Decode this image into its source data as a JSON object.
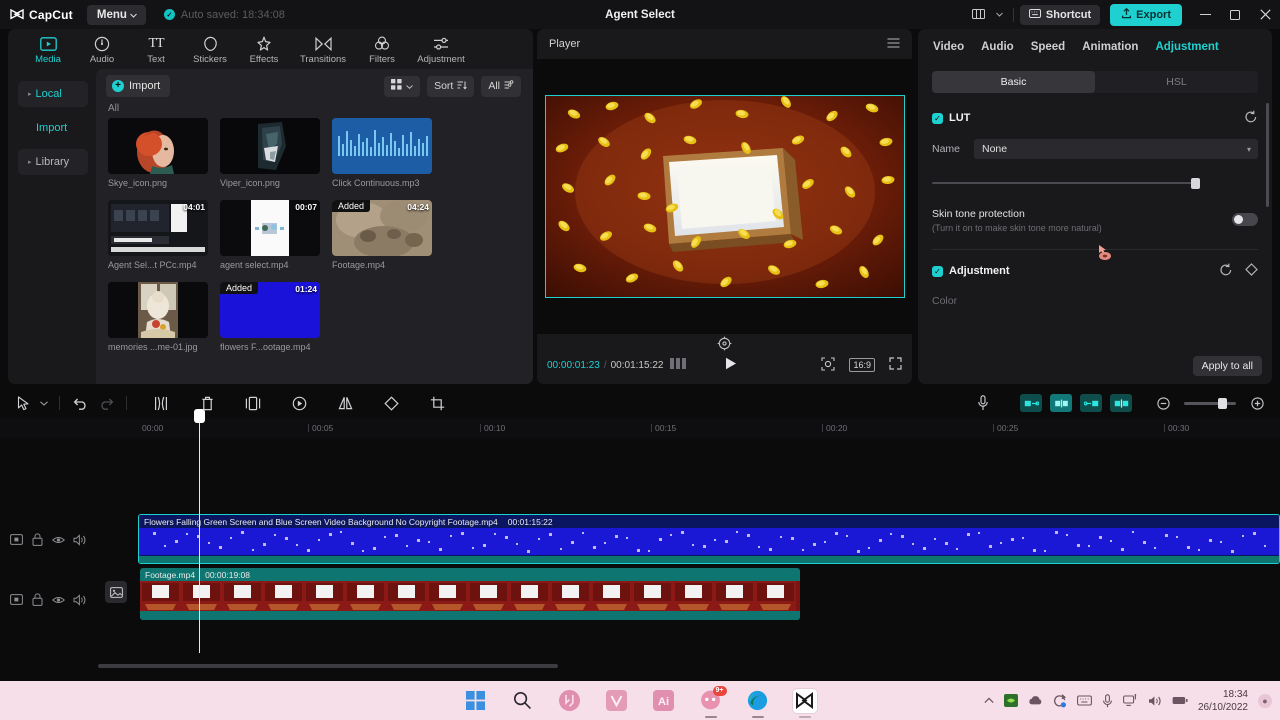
{
  "titlebar": {
    "app_name": "CapCut",
    "menu_label": "Menu",
    "autosave_text": "Auto saved: 18:34:08",
    "project_title": "Agent Select",
    "shortcut_label": "Shortcut",
    "export_label": "Export",
    "layout_icon": "layout-icon",
    "minimize_icon": "minimize-icon",
    "maximize_icon": "maximize-icon",
    "close_icon": "close-icon",
    "accent_color": "#1fd0d0"
  },
  "tooltabs": [
    {
      "label": "Media",
      "icon": "media-icon",
      "active": true
    },
    {
      "label": "Audio",
      "icon": "audio-icon",
      "active": false
    },
    {
      "label": "Text",
      "icon": "text-icon",
      "active": false
    },
    {
      "label": "Stickers",
      "icon": "stickers-icon",
      "active": false
    },
    {
      "label": "Effects",
      "icon": "effects-icon",
      "active": false
    },
    {
      "label": "Transitions",
      "icon": "transitions-icon",
      "active": false
    },
    {
      "label": "Filters",
      "icon": "filters-icon",
      "active": false
    },
    {
      "label": "Adjustment",
      "icon": "adjustment-icon",
      "active": false
    }
  ],
  "sidenav": [
    {
      "label": "Local",
      "active": true
    },
    {
      "label": "Import",
      "active": false
    },
    {
      "label": "Library",
      "active": false
    }
  ],
  "media": {
    "import_label": "Import",
    "sort_label": "Sort",
    "filter_label": "All",
    "group_label": "All",
    "view_icon": "grid-view-icon",
    "items": [
      {
        "name": "Skye_icon.png",
        "duration": "",
        "added": false,
        "kind": "image-portrait-red"
      },
      {
        "name": "Viper_icon.png",
        "duration": "",
        "added": false,
        "kind": "image-portrait-dark"
      },
      {
        "name": "Click Continuous.mp3",
        "duration": "",
        "added": false,
        "kind": "audio-waveform"
      },
      {
        "name": "Agent Sel...t PCc.mp4",
        "duration": "04:01",
        "added": false,
        "kind": "video-ui"
      },
      {
        "name": "agent select.mp4",
        "duration": "00:07",
        "added": false,
        "kind": "video-white"
      },
      {
        "name": "Footage.mp4",
        "duration": "04:24",
        "added": true,
        "added_label": "Added",
        "kind": "video-sepia"
      },
      {
        "name": "memories ...me-01.jpg",
        "duration": "",
        "added": false,
        "kind": "image-memories"
      },
      {
        "name": "flowers F...ootage.mp4",
        "duration": "01:24",
        "added": true,
        "added_label": "Added",
        "kind": "video-blue"
      }
    ]
  },
  "player": {
    "title": "Player",
    "menu_icon": "hamburger-icon",
    "current_time": "00:00:01:23",
    "separator": "/",
    "total_time": "00:01:15:22",
    "frames_icon": "frames-icon",
    "play_icon": "play-icon",
    "snapshot_icon": "snapshot-icon",
    "aspect_ratio": "16:9",
    "fullscreen_icon": "fullscreen-icon",
    "reset_icon": "reset-position-icon"
  },
  "inspector": {
    "tabs": [
      {
        "label": "Video",
        "active": false
      },
      {
        "label": "Audio",
        "active": false
      },
      {
        "label": "Speed",
        "active": false
      },
      {
        "label": "Animation",
        "active": false
      },
      {
        "label": "Adjustment",
        "active": true
      }
    ],
    "segments": [
      {
        "label": "Basic",
        "active": true
      },
      {
        "label": "HSL",
        "active": false
      }
    ],
    "lut": {
      "title": "LUT",
      "reset_icon": "reset-icon",
      "name_label": "Name",
      "name_value": "None",
      "intensity_value": 100
    },
    "skin_tone": {
      "title": "Skin tone protection",
      "hint": "(Turn it on to make skin tone more natural)",
      "enabled": false
    },
    "adjustment": {
      "title": "Adjustment",
      "reset_icon": "reset-icon",
      "keyframe_icon": "keyframe-icon",
      "color_label": "Color"
    },
    "apply_to_all": "Apply to all"
  },
  "timeline": {
    "tools": [
      {
        "name": "select-tool",
        "icon": "cursor-icon",
        "state": "normal"
      },
      {
        "name": "select-dropdown",
        "icon": "chevron-down-icon",
        "state": "normal"
      },
      {
        "name": "undo",
        "icon": "undo-icon",
        "state": "normal"
      },
      {
        "name": "redo",
        "icon": "redo-icon",
        "state": "disabled"
      },
      {
        "name": "split",
        "icon": "split-icon",
        "state": "normal"
      },
      {
        "name": "delete",
        "icon": "trash-icon",
        "state": "normal"
      },
      {
        "name": "freeze",
        "icon": "freeze-icon",
        "state": "normal"
      },
      {
        "name": "speed",
        "icon": "speed-icon",
        "state": "normal"
      },
      {
        "name": "mirror",
        "icon": "mirror-icon",
        "state": "normal"
      },
      {
        "name": "rotate",
        "icon": "rotate-icon",
        "state": "normal"
      },
      {
        "name": "crop",
        "icon": "crop-icon",
        "state": "normal"
      }
    ],
    "right_tools": [
      {
        "name": "record-audio",
        "icon": "microphone-icon"
      },
      {
        "name": "clip-start",
        "icon": "clip-left-icon"
      },
      {
        "name": "clip-both",
        "icon": "clip-both-icon"
      },
      {
        "name": "clip-end",
        "icon": "clip-right-icon"
      },
      {
        "name": "clip-split",
        "icon": "clip-split-icon"
      },
      {
        "name": "zoom-out",
        "icon": "zoom-out-icon"
      },
      {
        "name": "zoom-in",
        "icon": "zoom-in-icon"
      }
    ],
    "ruler_ticks": [
      "00:00",
      "00:05",
      "00:10",
      "00:15",
      "00:20",
      "00:25",
      "00:30"
    ],
    "playhead_position": "00:00:01:23",
    "track_controls": [
      {
        "icon": "track-video-icon"
      },
      {
        "icon": "lock-icon"
      },
      {
        "icon": "eye-icon"
      },
      {
        "icon": "volume-icon"
      }
    ],
    "clips": [
      {
        "name": "Flowers Falling Green Screen and Blue Screen Video Background No Copyright Footage.mp4",
        "duration": "00:01:15:22",
        "selected": true,
        "kind": "blue-noise"
      },
      {
        "name": "Footage.mp4",
        "duration": "00:00:19:08",
        "selected": false,
        "kind": "filmstrip-red"
      }
    ]
  },
  "taskbar": {
    "apps": [
      {
        "name": "start-button",
        "icon": "windows-icon",
        "badge": "",
        "active": false,
        "running": false
      },
      {
        "name": "search-button",
        "icon": "search-icon",
        "badge": "",
        "active": false,
        "running": false
      },
      {
        "name": "taskbar-app-valorant",
        "icon": "valorant-icon",
        "badge": "",
        "active": false,
        "running": false
      },
      {
        "name": "taskbar-app-vegas",
        "icon": "vegas-icon",
        "badge": "",
        "active": false,
        "running": false
      },
      {
        "name": "taskbar-app-illustrator",
        "icon": "illustrator-icon",
        "badge": "",
        "active": false,
        "running": false
      },
      {
        "name": "taskbar-app-chat",
        "icon": "chat-icon",
        "badge": "9+",
        "active": false,
        "running": true
      },
      {
        "name": "taskbar-app-edge",
        "icon": "edge-icon",
        "badge": "",
        "active": false,
        "running": true
      },
      {
        "name": "taskbar-app-capcut",
        "icon": "capcut-icon",
        "badge": "",
        "active": true,
        "running": true
      }
    ],
    "tray": [
      {
        "name": "tray-overflow",
        "icon": "chevron-up-icon"
      },
      {
        "name": "tray-nvidia",
        "icon": "nvidia-icon"
      },
      {
        "name": "tray-cloud",
        "icon": "cloud-icon"
      },
      {
        "name": "tray-sync",
        "icon": "sync-icon"
      },
      {
        "name": "tray-keyboard",
        "icon": "keyboard-icon"
      },
      {
        "name": "tray-mic",
        "icon": "microphone-icon"
      },
      {
        "name": "tray-network",
        "icon": "network-icon"
      },
      {
        "name": "tray-volume",
        "icon": "volume-icon"
      },
      {
        "name": "tray-battery",
        "icon": "battery-icon"
      }
    ],
    "time": "18:34",
    "date": "26/10/2022",
    "notification_icon": "notification-icon"
  }
}
